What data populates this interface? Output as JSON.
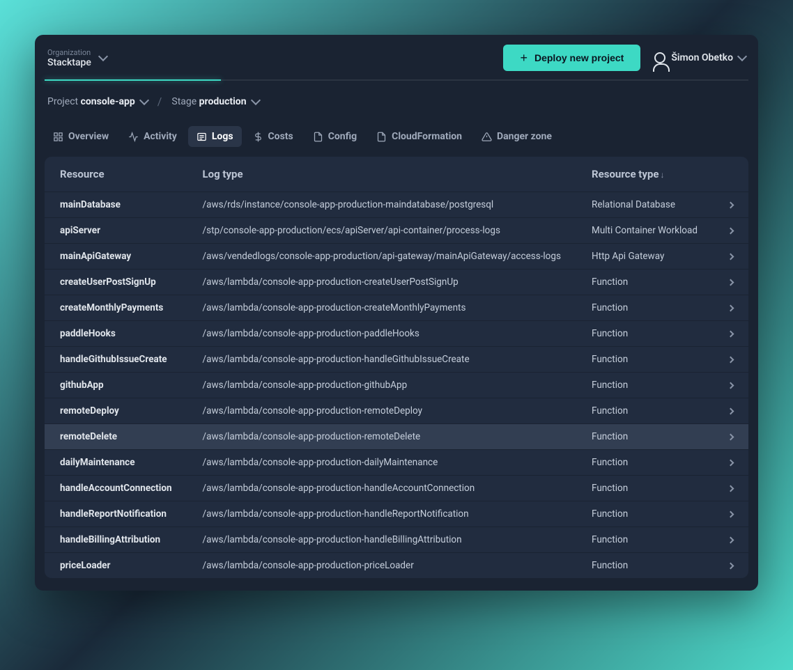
{
  "header": {
    "org_label": "Organization",
    "org_name": "Stacktape",
    "deploy_button": "Deploy new project",
    "user_name": "Šimon Obetko"
  },
  "breadcrumb": {
    "project_label": "Project",
    "project_name": "console-app",
    "stage_label": "Stage",
    "stage_name": "production"
  },
  "tabs": [
    {
      "id": "overview",
      "label": "Overview",
      "icon": "grid"
    },
    {
      "id": "activity",
      "label": "Activity",
      "icon": "activity"
    },
    {
      "id": "logs",
      "label": "Logs",
      "icon": "list",
      "active": true
    },
    {
      "id": "costs",
      "label": "Costs",
      "icon": "dollar"
    },
    {
      "id": "config",
      "label": "Config",
      "icon": "file"
    },
    {
      "id": "cloudformation",
      "label": "CloudFormation",
      "icon": "file"
    },
    {
      "id": "danger",
      "label": "Danger zone",
      "icon": "alert"
    }
  ],
  "table": {
    "columns": [
      "Resource",
      "Log type",
      "Resource type"
    ],
    "sort_column": 2,
    "sort_dir": "desc",
    "rows": [
      {
        "resource": "mainDatabase",
        "log_type": "/aws/rds/instance/console-app-production-maindatabase/postgresql",
        "resource_type": "Relational Database"
      },
      {
        "resource": "apiServer",
        "log_type": "/stp/console-app-production/ecs/apiServer/api-container/process-logs",
        "resource_type": "Multi Container Workload"
      },
      {
        "resource": "mainApiGateway",
        "log_type": "/aws/vendedlogs/console-app-production/api-gateway/mainApiGateway/access-logs",
        "resource_type": "Http Api Gateway"
      },
      {
        "resource": "createUserPostSignUp",
        "log_type": "/aws/lambda/console-app-production-createUserPostSignUp",
        "resource_type": "Function"
      },
      {
        "resource": "createMonthlyPayments",
        "log_type": "/aws/lambda/console-app-production-createMonthlyPayments",
        "resource_type": "Function"
      },
      {
        "resource": "paddleHooks",
        "log_type": "/aws/lambda/console-app-production-paddleHooks",
        "resource_type": "Function"
      },
      {
        "resource": "handleGithubIssueCreate",
        "log_type": "/aws/lambda/console-app-production-handleGithubIssueCreate",
        "resource_type": "Function"
      },
      {
        "resource": "githubApp",
        "log_type": "/aws/lambda/console-app-production-githubApp",
        "resource_type": "Function"
      },
      {
        "resource": "remoteDeploy",
        "log_type": "/aws/lambda/console-app-production-remoteDeploy",
        "resource_type": "Function"
      },
      {
        "resource": "remoteDelete",
        "log_type": "/aws/lambda/console-app-production-remoteDelete",
        "resource_type": "Function",
        "highlighted": true
      },
      {
        "resource": "dailyMaintenance",
        "log_type": "/aws/lambda/console-app-production-dailyMaintenance",
        "resource_type": "Function"
      },
      {
        "resource": "handleAccountConnection",
        "log_type": "/aws/lambda/console-app-production-handleAccountConnection",
        "resource_type": "Function"
      },
      {
        "resource": "handleReportNotification",
        "log_type": "/aws/lambda/console-app-production-handleReportNotification",
        "resource_type": "Function"
      },
      {
        "resource": "handleBillingAttribution",
        "log_type": "/aws/lambda/console-app-production-handleBillingAttribution",
        "resource_type": "Function"
      },
      {
        "resource": "priceLoader",
        "log_type": "/aws/lambda/console-app-production-priceLoader",
        "resource_type": "Function"
      }
    ]
  },
  "colors": {
    "accent": "#3dd9c4",
    "bg_dark": "#1a2332",
    "bg_card": "#212c3f"
  }
}
